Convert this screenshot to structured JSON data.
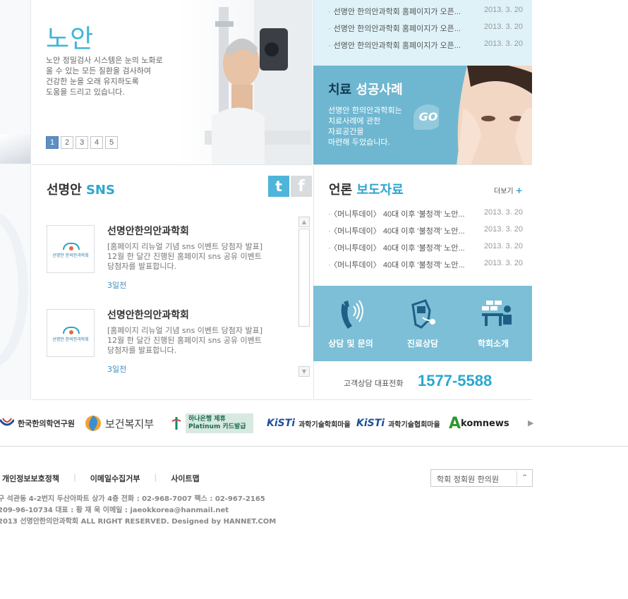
{
  "hero": {
    "title": "노안",
    "desc": [
      "노안 정밀검사 시스템은 눈의 노화로",
      "올 수 있는 모든 질환을 검사하여",
      "건강한 눈을 오래 유지하도록",
      "도움을 드리고 있습니다."
    ],
    "pages": [
      "1",
      "2",
      "3",
      "4",
      "5"
    ],
    "active_page": "1"
  },
  "top_news": [
    {
      "title": "선명안 한의안과학회 홈페이지가 오픈...",
      "date": "2013. 3. 20"
    },
    {
      "title": "선명안 한의안과학회 홈페이지가 오픈...",
      "date": "2013. 3. 20"
    },
    {
      "title": "선명안 한의안과학회 홈페이지가 오픈...",
      "date": "2013. 3. 20"
    }
  ],
  "treatment": {
    "title_part1": "치료",
    "title_part2": "성공사례",
    "desc": [
      "선명안 한의안과학회는",
      "치료사례에 관한",
      "자료공간을",
      "마련해 두었습니다."
    ],
    "go_label": "GO"
  },
  "sns": {
    "title_part1": "선명안",
    "title_part2": "SNS",
    "twitter_icon": "t",
    "facebook_icon": "f",
    "logo_text": "선명안 한의안과학회",
    "posts": [
      {
        "name": "선명안한의안과학회",
        "text": [
          "[홈페이지 리뉴얼 기념 sns 이벤트 당첨자 발표]",
          "12월 한 달간 진행된 홈페이지 sns 공유 이벤트",
          "당첨자를 발표합니다."
        ],
        "time": "3일전"
      },
      {
        "name": "선명안한의안과학회",
        "text": [
          "[홈페이지 리뉴얼 기념 sns 이벤트 당첨자 발표]",
          "12월 한 달간 진행된 홈페이지 sns 공유 이벤트",
          "당첨자를 발표합니다."
        ],
        "time": "3일전"
      }
    ],
    "scroll_up": "▲",
    "scroll_down": "▼"
  },
  "press": {
    "title_part1": "언론",
    "title_part2": "보도자료",
    "more_label": "더보기",
    "more_plus": "+",
    "items": [
      {
        "title": "〈머니투데이〉 40대 이후 '불청객' 노안...",
        "date": "2013. 3. 20"
      },
      {
        "title": "〈머니투데이〉 40대 이후 '불청객' 노안...",
        "date": "2013. 3. 20"
      },
      {
        "title": "〈머니투데이〉 40대 이후 '불청객' 노안...",
        "date": "2013. 3. 20"
      },
      {
        "title": "〈머니투데이〉 40대 이후 '불청객' 노안...",
        "date": "2013. 3. 20"
      }
    ]
  },
  "quick_menu": [
    {
      "label": "상담 및 문의",
      "icon": "phone-icon"
    },
    {
      "label": "진료상담",
      "icon": "consult-icon"
    },
    {
      "label": "학회소개",
      "icon": "society-icon"
    }
  ],
  "call_center": {
    "label": "고객상담 대표전화",
    "number": "1577-5588"
  },
  "partners": [
    {
      "name": "한국한의학연구원"
    },
    {
      "name": "보건복지부"
    },
    {
      "name": "하나은행 제휴 Platinum 카드발급"
    },
    {
      "name": "과학기술학회마을"
    },
    {
      "name": "과학기술협회마을"
    },
    {
      "name": "komnews"
    }
  ],
  "partner_next": "▶",
  "footer": {
    "links": [
      "개인정보보호정책",
      "이메일수집거부",
      "사이트맵"
    ],
    "separator": "|",
    "select_value": "학회 정회원 한의원",
    "select_arrow": "^",
    "info": [
      "구 석관동 4-2번지 두산아파트 상가 4층    전화 : 02-968-7007    팩스 : 02-967-2165",
      "209-96-10734    대표 : 황 재 욱    이메일 : jaeokkorea@hanmail.net",
      "2013 선명안한의안과학회 ALL RIGHT RESERVED.   Designed by HANNET.COM"
    ]
  },
  "colors": {
    "accent": "#2fa6cf",
    "banner": "#6fb7d0",
    "quick": "#7cbfd6",
    "news_bg": "#dff2f8"
  }
}
